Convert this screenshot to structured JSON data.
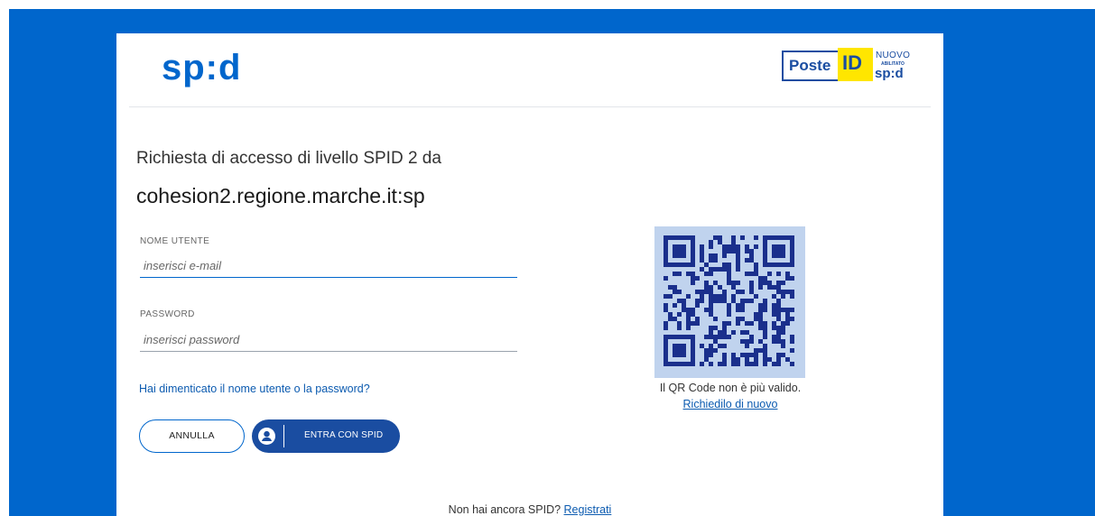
{
  "brand": {
    "logo_text": "sp:d",
    "poste_text": "Poste",
    "id_text": "ID",
    "nuovo_text": "NUOVO",
    "abilitato_text": "ABILITATO",
    "mini_spid_text": "sp:d",
    "primary_color": "#0066cc",
    "poste_blue": "#1a4da1",
    "poste_yellow": "#ffe600"
  },
  "request": {
    "intro": "Richiesta di accesso di livello SPID 2 da",
    "sp_name": "cohesion2.regione.marche.it:sp"
  },
  "form": {
    "username_label": "NOME UTENTE",
    "username_placeholder": "inserisci e-mail",
    "username_value": "",
    "password_label": "PASSWORD",
    "password_placeholder": "inserisci password",
    "password_value": "",
    "forgot_link": "Hai dimenticato il nome utente o la password?",
    "cancel_label": "ANNULLA",
    "submit_label": "ENTRA CON SPID",
    "submit_icon": "user-circle-icon"
  },
  "qr": {
    "message": "Il QR Code non è più valido.",
    "renew_link": "Richiedilo di nuovo"
  },
  "footer": {
    "question": "Non hai ancora SPID? ",
    "register_link": "Registrati"
  }
}
